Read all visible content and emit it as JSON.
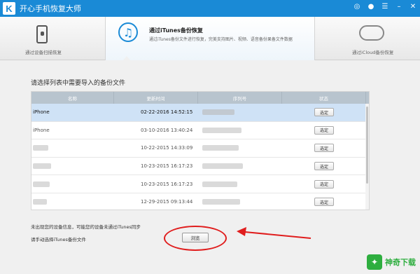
{
  "app": {
    "logo": "K",
    "title": "开心手机恢复大师"
  },
  "window_controls": [
    "wechat-icon",
    "chat-icon",
    "menu-icon",
    "minimize-icon",
    "close-icon"
  ],
  "tabs": {
    "device": {
      "label": "通过设备扫描恢复",
      "icon": "phone-icon"
    },
    "itunes": {
      "title": "通过iTunes备份恢复",
      "desc": "通过iTunes备份文件进行恢复，完美支持图片、视频、语音备份果备文件数据",
      "icon": "music-note-icon"
    },
    "icloud": {
      "label": "通过iCloud备份恢复",
      "icon": "cloud-icon"
    }
  },
  "panel": {
    "title": "请选择列表中需要导入的备份文件"
  },
  "table": {
    "headers": [
      "名称",
      "更新时间",
      "序列号",
      "状态"
    ],
    "rows": [
      {
        "name": "iPhone",
        "date": "02-22-2016 14:52:15",
        "action": "选定",
        "selected": true
      },
      {
        "name": "iPhone",
        "date": "03-10-2016 13:40:24",
        "action": "选定",
        "selected": false
      },
      {
        "name": "",
        "date": "10-22-2015 14:33:09",
        "action": "选定",
        "selected": false
      },
      {
        "name": "",
        "date": "10-23-2015 16:17:23",
        "action": "选定",
        "selected": false
      },
      {
        "name": "",
        "date": "10-23-2015 16:17:23",
        "action": "选定",
        "selected": false
      },
      {
        "name": "",
        "date": "12-29-2015 09:13:44",
        "action": "选定",
        "selected": false
      }
    ]
  },
  "notes": {
    "line1": "未出现您的设备信息，可能您的设备未通过iTunes同步",
    "line2": "请手动选择iTunes备份文件"
  },
  "browse_label": "浏览",
  "watermark": {
    "text": "神奇下载"
  },
  "colors": {
    "titlebar": "#1a8ad6",
    "selected_row": "#cfe2f6",
    "annotation": "#e01d1d",
    "watermark": "#2eae3f"
  }
}
